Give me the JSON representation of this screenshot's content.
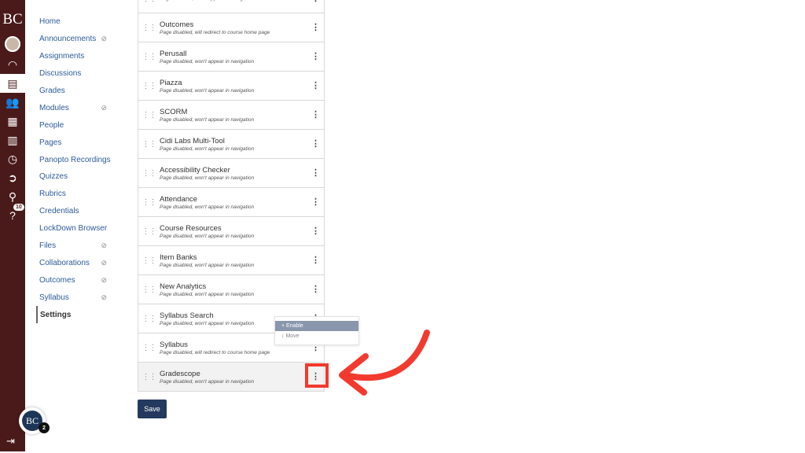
{
  "global_nav": {
    "logo": "BC",
    "help_badge": "10",
    "bottom_logo": "BC",
    "bottom_badge": "2",
    "icons": [
      "avatar",
      "dashboard-icon",
      "courses-icon",
      "groups-icon",
      "calendar-icon",
      "inbox-icon",
      "history-icon",
      "commons-icon",
      "search-icon",
      "help-icon"
    ]
  },
  "course_nav": [
    {
      "label": "Home",
      "hidden": false
    },
    {
      "label": "Announcements",
      "hidden": true
    },
    {
      "label": "Assignments",
      "hidden": false
    },
    {
      "label": "Discussions",
      "hidden": false
    },
    {
      "label": "Grades",
      "hidden": false
    },
    {
      "label": "Modules",
      "hidden": true
    },
    {
      "label": "People",
      "hidden": false
    },
    {
      "label": "Pages",
      "hidden": false
    },
    {
      "label": "Panopto Recordings",
      "hidden": false
    },
    {
      "label": "Quizzes",
      "hidden": false
    },
    {
      "label": "Rubrics",
      "hidden": false
    },
    {
      "label": "Credentials",
      "hidden": false
    },
    {
      "label": "LockDown Browser",
      "hidden": false
    },
    {
      "label": "Files",
      "hidden": true
    },
    {
      "label": "Collaborations",
      "hidden": true
    },
    {
      "label": "Outcomes",
      "hidden": true
    },
    {
      "label": "Syllabus",
      "hidden": true
    },
    {
      "label": "Settings",
      "hidden": false,
      "selected": true
    }
  ],
  "nav_items": [
    {
      "name": "",
      "status": "Page disabled, won't appear in navigation"
    },
    {
      "name": "Outcomes",
      "status": "Page disabled, will redirect to course home page"
    },
    {
      "name": "Perusall",
      "status": "Page disabled, won't appear in navigation"
    },
    {
      "name": "Piazza",
      "status": "Page disabled, won't appear in navigation"
    },
    {
      "name": "SCORM",
      "status": "Page disabled, won't appear in navigation"
    },
    {
      "name": "Cidi Labs Multi-Tool",
      "status": "Page disabled, won't appear in navigation"
    },
    {
      "name": "Accessibility Checker",
      "status": "Page disabled, won't appear in navigation"
    },
    {
      "name": "Attendance",
      "status": "Page disabled, won't appear in navigation"
    },
    {
      "name": "Course Resources",
      "status": "Page disabled, won't appear in navigation"
    },
    {
      "name": "Item Banks",
      "status": "Page disabled, won't appear in navigation"
    },
    {
      "name": "New Analytics",
      "status": "Page disabled, won't appear in navigation"
    },
    {
      "name": "Syllabus Search",
      "status": "Page disabled, won't appear in navigation"
    },
    {
      "name": "Syllabus",
      "status": "Page disabled, will redirect to course home page"
    },
    {
      "name": "Gradescope",
      "status": "Page disabled, won't appear in navigation"
    }
  ],
  "menu": {
    "enable": "+ Enable",
    "move": "↕ Move"
  },
  "save_label": "Save",
  "colors": {
    "sidebar": "#4a1a1a",
    "link": "#2d5b9a",
    "annotation": "#f23a2e",
    "save": "#24395e"
  }
}
